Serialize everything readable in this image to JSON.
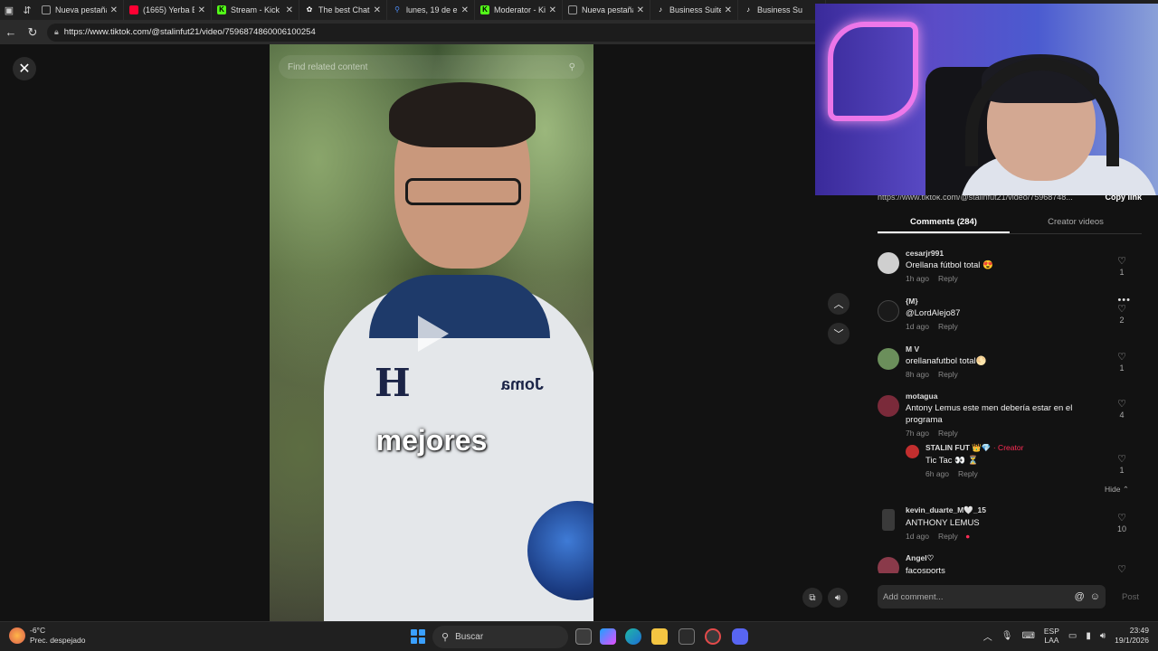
{
  "browser": {
    "tabs": [
      {
        "label": "Nueva pestaña",
        "icon": "page-icon",
        "color": "#888888"
      },
      {
        "label": "(1665) Yerba Br",
        "icon": "youtube-icon",
        "color": "#ff0033"
      },
      {
        "label": "Stream - Kick D",
        "icon": "kick-icon",
        "color": "#53fc18"
      },
      {
        "label": "The best ChatB",
        "icon": "openai-icon",
        "color": "#ffffff"
      },
      {
        "label": "lunes, 19 de en",
        "icon": "search-icon",
        "color": "#4c8bf5"
      },
      {
        "label": "Moderator - Kic",
        "icon": "kick-icon",
        "color": "#53fc18"
      },
      {
        "label": "Nueva pestaña",
        "icon": "page-icon",
        "color": "#888888"
      },
      {
        "label": "Business Suite |",
        "icon": "tiktok-icon",
        "color": "#ffffff"
      },
      {
        "label": "Business Su",
        "icon": "tiktok-icon",
        "color": "#ffffff"
      }
    ],
    "url": "https://www.tiktok.com/@stalinfut21/video/7596874860006100254"
  },
  "video": {
    "search_placeholder": "Find related content",
    "caption": "mejores",
    "shirt_letter": "H",
    "shirt_brand": "Joma"
  },
  "panel": {
    "share_link": "https://www.tiktok.com/@stalinfut21/video/75968748...",
    "copy_link": "Copy link",
    "tab_comments": "Comments (284)",
    "tab_creator": "Creator videos",
    "comments": [
      {
        "user": "cesarjr991",
        "text": "Orellana fútbol total 😍",
        "time": "1h ago",
        "reply": "Reply",
        "likes": "1",
        "avatar_color": "#cfcfcf"
      },
      {
        "user": "{M}",
        "text": "@LordAlejo87",
        "time": "1d ago",
        "reply": "Reply",
        "likes": "2",
        "avatar_color": "#1a1a1a"
      },
      {
        "user": "M V",
        "text": "orellanafutbol total🌕",
        "time": "8h ago",
        "reply": "Reply",
        "likes": "1",
        "avatar_color": "#6b8f5b"
      },
      {
        "user": "motagua",
        "text": "Antony Lemus este men debería estar en el programa",
        "time": "7h ago",
        "reply": "Reply",
        "likes": "4",
        "avatar_color": "#7a2a3a"
      },
      {
        "user": "STALIN FUT 👑💎",
        "creator_tag": "· Creator",
        "text": "Tic Tac 👀 ⏳",
        "time": "6h ago",
        "reply": "Reply",
        "likes": "1",
        "avatar_color": "#c22e2e"
      },
      {
        "user": "kevin_duarte_M🤍_15",
        "text": "ANTHONY LEMUS",
        "time": "1d ago",
        "reply": "Reply",
        "likes": "10",
        "avatar_color": "#3a3a3a"
      },
      {
        "user": "Angel♡",
        "text": "facosports",
        "time": "",
        "reply": "",
        "likes": "",
        "avatar_color": "#8a3a4a"
      }
    ],
    "hide_label": "Hide ⌃",
    "add_comment_placeholder": "Add comment...",
    "post_label": "Post"
  },
  "taskbar": {
    "weather_temp": "-6°C",
    "weather_desc": "Prec. despejado",
    "search_label": "Buscar",
    "lang_top": "ESP",
    "lang_bottom": "LAA",
    "time": "23:49",
    "date": "19/1/2026"
  }
}
